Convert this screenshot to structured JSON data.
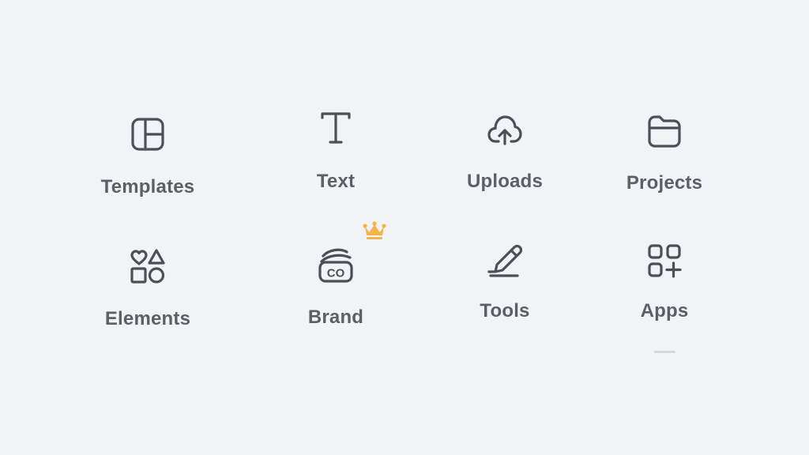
{
  "colors": {
    "background": "#f2f3f7",
    "icon": "#4b5057",
    "label": "#5b6066",
    "premium_crown": "#f3b54a"
  },
  "nav": {
    "templates": {
      "label": "Templates",
      "icon": "templates-icon"
    },
    "text": {
      "label": "Text",
      "icon": "text-icon"
    },
    "uploads": {
      "label": "Uploads",
      "icon": "cloud-upload-icon"
    },
    "projects": {
      "label": "Projects",
      "icon": "folder-icon"
    },
    "elements": {
      "label": "Elements",
      "icon": "shapes-icon"
    },
    "brand": {
      "label": "Brand",
      "icon": "brand-kit-icon",
      "premium_icon": "crown-icon",
      "badge_text": "CO"
    },
    "tools": {
      "label": "Tools",
      "icon": "pen-icon"
    },
    "apps": {
      "label": "Apps",
      "icon": "apps-grid-icon"
    }
  }
}
